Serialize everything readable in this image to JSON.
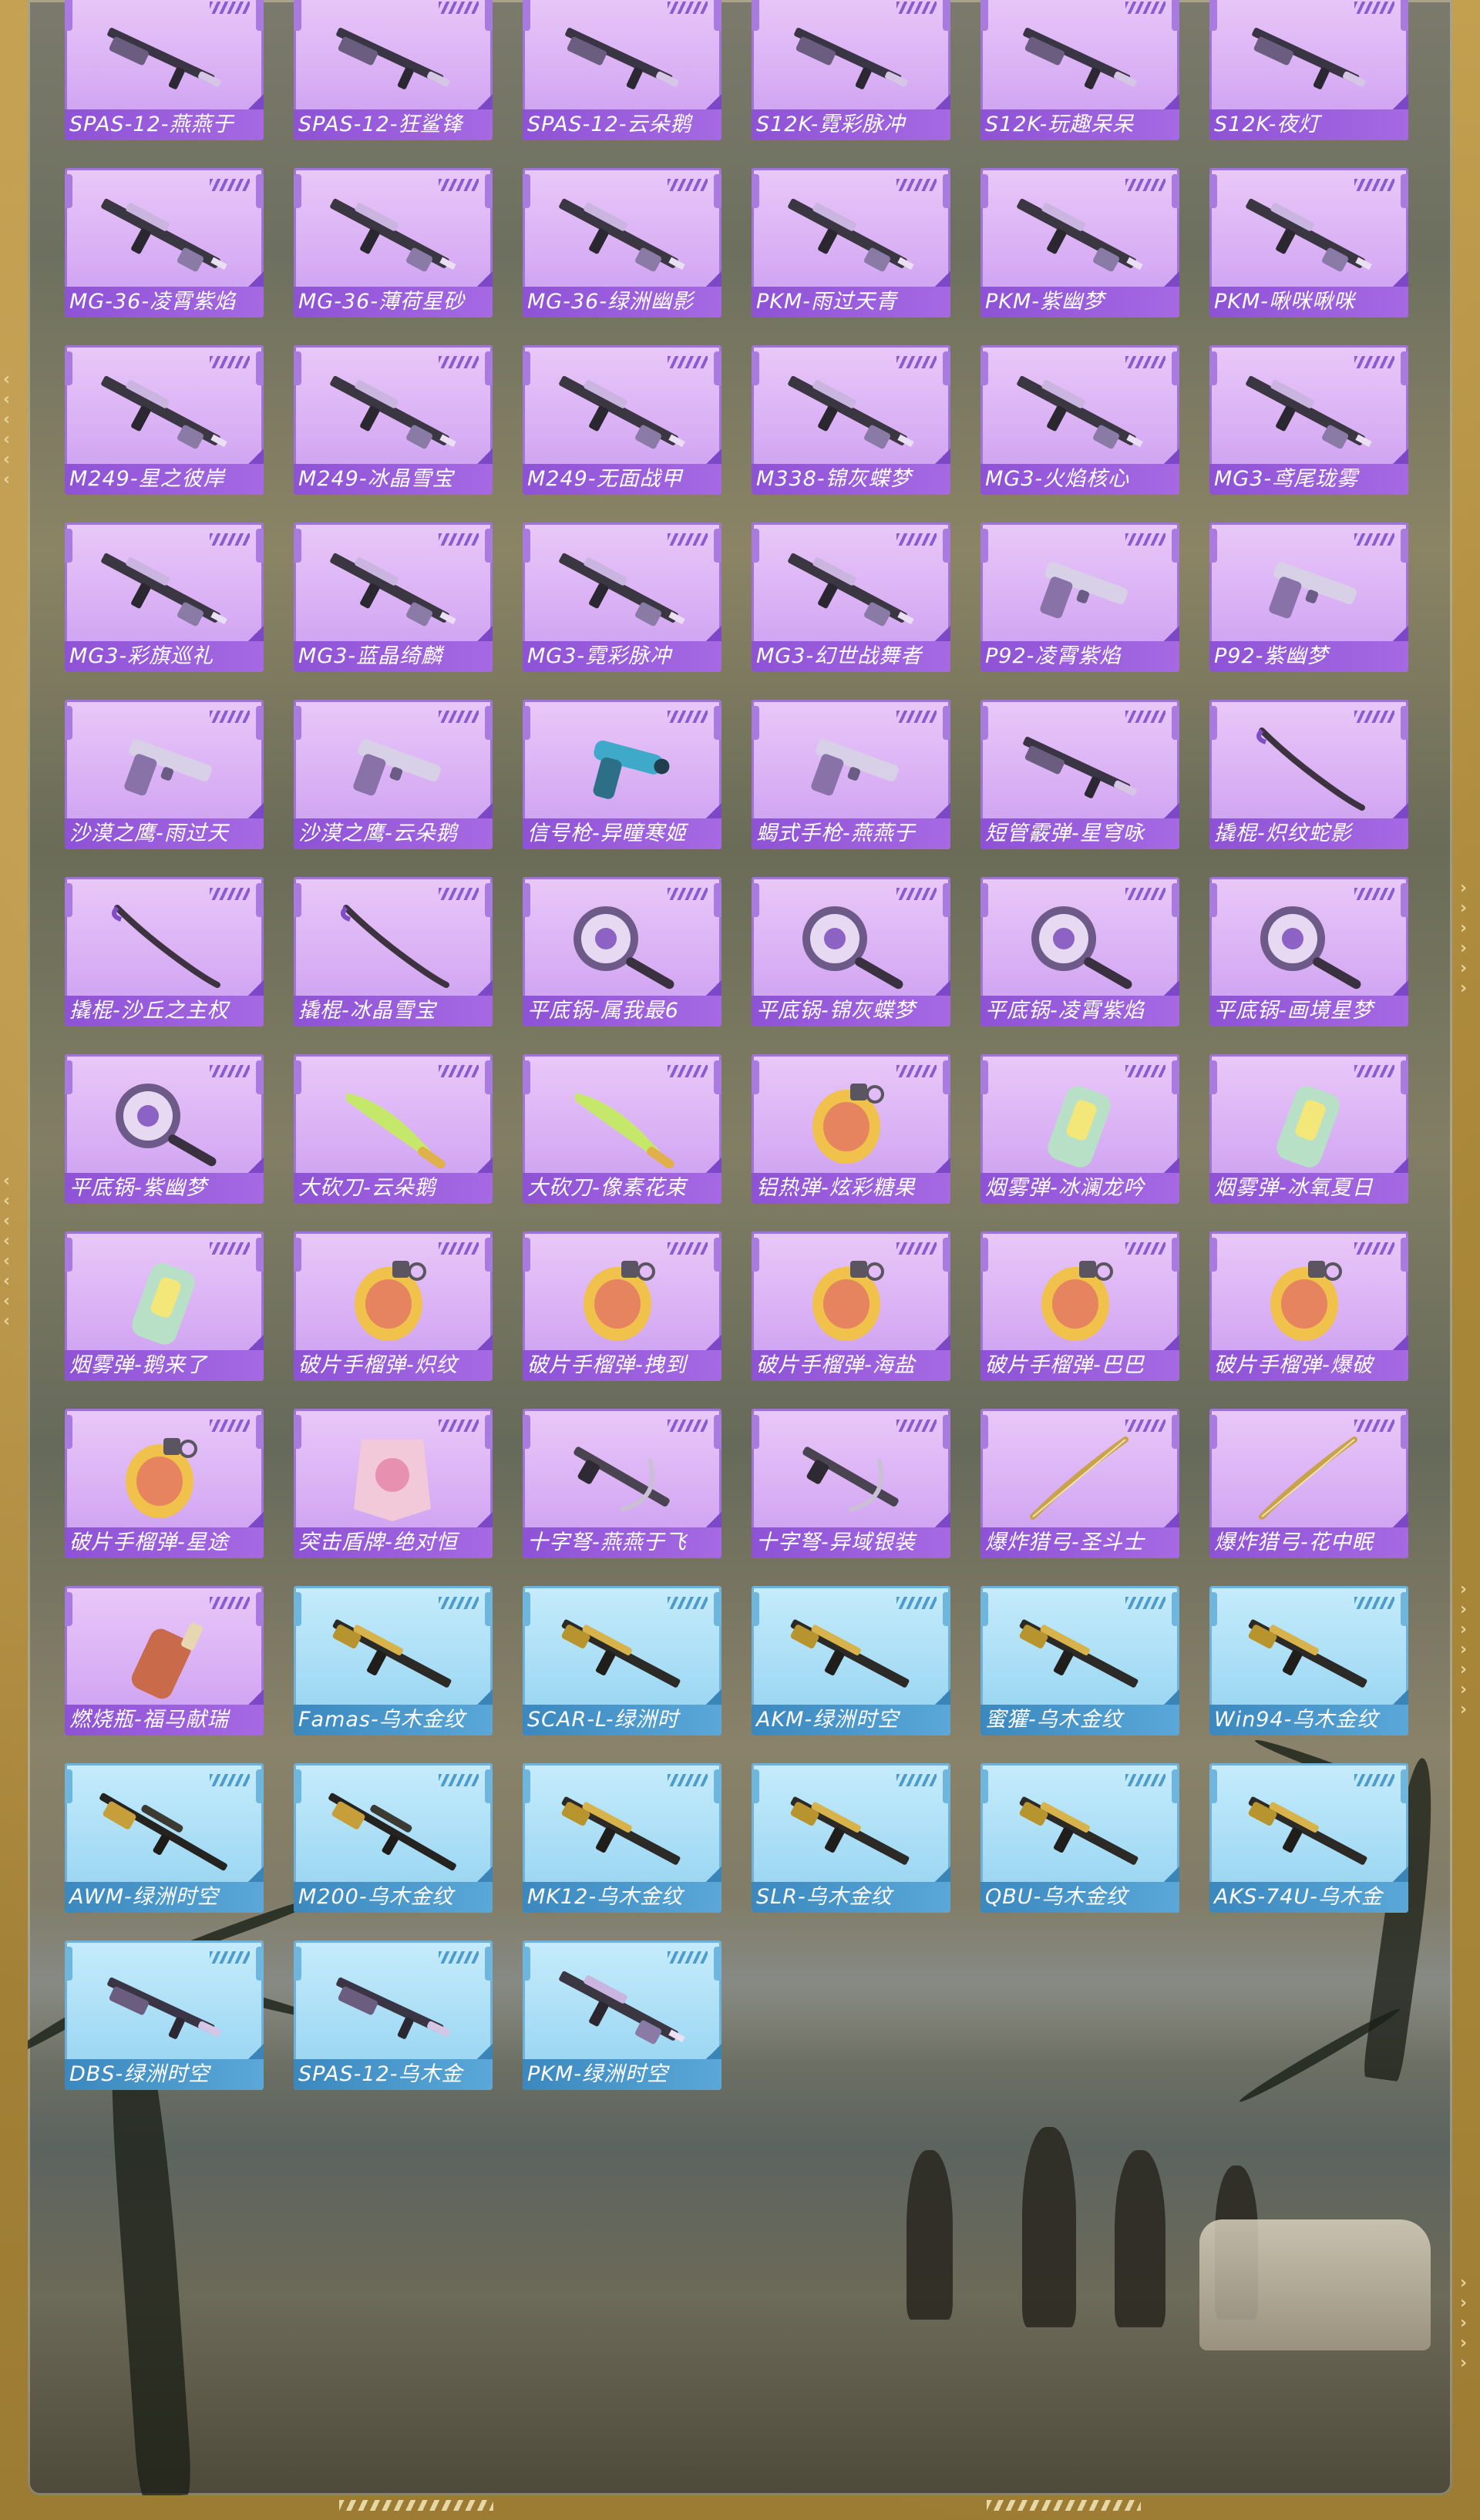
{
  "colors": {
    "frame_gold": "#b7913f",
    "card_purple": "#d8aef4",
    "card_purple_label": "#9a5fdd",
    "card_blue": "#a6dcf5",
    "card_blue_label": "#4a99cd"
  },
  "items": [
    {
      "label": "SPAS-12-燕燕于",
      "rarity": "purple",
      "icon": "shotgun-icon"
    },
    {
      "label": "SPAS-12-狂鲨锋",
      "rarity": "purple",
      "icon": "shotgun-icon"
    },
    {
      "label": "SPAS-12-云朵鹅",
      "rarity": "purple",
      "icon": "shotgun-icon"
    },
    {
      "label": "S12K-霓彩脉冲",
      "rarity": "purple",
      "icon": "shotgun-icon"
    },
    {
      "label": "S12K-玩趣呆呆",
      "rarity": "purple",
      "icon": "shotgun-icon"
    },
    {
      "label": "S12K-夜灯",
      "rarity": "purple",
      "icon": "shotgun-icon"
    },
    {
      "label": "MG-36-凌霄紫焰",
      "rarity": "purple",
      "icon": "machine-gun-icon"
    },
    {
      "label": "MG-36-薄荷星砂",
      "rarity": "purple",
      "icon": "machine-gun-icon"
    },
    {
      "label": "MG-36-绿洲幽影",
      "rarity": "purple",
      "icon": "machine-gun-icon"
    },
    {
      "label": "PKM-雨过天青",
      "rarity": "purple",
      "icon": "machine-gun-icon"
    },
    {
      "label": "PKM-紫幽梦",
      "rarity": "purple",
      "icon": "machine-gun-icon"
    },
    {
      "label": "PKM-啾咪啾咪",
      "rarity": "purple",
      "icon": "machine-gun-icon"
    },
    {
      "label": "M249-星之彼岸",
      "rarity": "purple",
      "icon": "machine-gun-icon"
    },
    {
      "label": "M249-冰晶雪宝",
      "rarity": "purple",
      "icon": "machine-gun-icon"
    },
    {
      "label": "M249-无面战甲",
      "rarity": "purple",
      "icon": "machine-gun-icon"
    },
    {
      "label": "M338-锦灰蝶梦",
      "rarity": "purple",
      "icon": "machine-gun-icon"
    },
    {
      "label": "MG3-火焰核心",
      "rarity": "purple",
      "icon": "machine-gun-icon"
    },
    {
      "label": "MG3-鸢尾珑雾",
      "rarity": "purple",
      "icon": "machine-gun-icon"
    },
    {
      "label": "MG3-彩旗巡礼",
      "rarity": "purple",
      "icon": "machine-gun-icon"
    },
    {
      "label": "MG3-蓝晶绮麟",
      "rarity": "purple",
      "icon": "machine-gun-icon"
    },
    {
      "label": "MG3-霓彩脉冲",
      "rarity": "purple",
      "icon": "machine-gun-icon"
    },
    {
      "label": "MG3-幻世战舞者",
      "rarity": "purple",
      "icon": "machine-gun-icon"
    },
    {
      "label": "P92-凌霄紫焰",
      "rarity": "purple",
      "icon": "pistol-icon"
    },
    {
      "label": "P92-紫幽梦",
      "rarity": "purple",
      "icon": "pistol-icon"
    },
    {
      "label": "沙漠之鹰-雨过天",
      "rarity": "purple",
      "icon": "pistol-icon"
    },
    {
      "label": "沙漠之鹰-云朵鹅",
      "rarity": "purple",
      "icon": "pistol-icon"
    },
    {
      "label": "信号枪-异瞳寒姬",
      "rarity": "purple",
      "icon": "flare-gun-icon"
    },
    {
      "label": "蝎式手枪-燕燕于",
      "rarity": "purple",
      "icon": "pistol-icon"
    },
    {
      "label": "短管霰弹-星穹咏",
      "rarity": "purple",
      "icon": "shotgun-icon"
    },
    {
      "label": "撬棍-炽纹蛇影",
      "rarity": "purple",
      "icon": "crowbar-icon"
    },
    {
      "label": "撬棍-沙丘之主权",
      "rarity": "purple",
      "icon": "crowbar-icon"
    },
    {
      "label": "撬棍-冰晶雪宝",
      "rarity": "purple",
      "icon": "crowbar-icon"
    },
    {
      "label": "平底锅-属我最6",
      "rarity": "purple",
      "icon": "pan-icon"
    },
    {
      "label": "平底锅-锦灰蝶梦",
      "rarity": "purple",
      "icon": "pan-icon"
    },
    {
      "label": "平底锅-凌霄紫焰",
      "rarity": "purple",
      "icon": "pan-icon"
    },
    {
      "label": "平底锅-画境星梦",
      "rarity": "purple",
      "icon": "pan-icon"
    },
    {
      "label": "平底锅-紫幽梦",
      "rarity": "purple",
      "icon": "pan-icon"
    },
    {
      "label": "大砍刀-云朵鹅",
      "rarity": "purple",
      "icon": "machete-icon"
    },
    {
      "label": "大砍刀-像素花束",
      "rarity": "purple",
      "icon": "machete-icon"
    },
    {
      "label": "铝热弹-炫彩糖果",
      "rarity": "purple",
      "icon": "grenade-icon"
    },
    {
      "label": "烟雾弹-冰澜龙吟",
      "rarity": "purple",
      "icon": "smoke-grenade-icon"
    },
    {
      "label": "烟雾弹-冰氧夏日",
      "rarity": "purple",
      "icon": "smoke-grenade-icon"
    },
    {
      "label": "烟雾弹-鹅来了",
      "rarity": "purple",
      "icon": "smoke-grenade-icon"
    },
    {
      "label": "破片手榴弹-炽纹",
      "rarity": "purple",
      "icon": "grenade-icon"
    },
    {
      "label": "破片手榴弹-拽到",
      "rarity": "purple",
      "icon": "grenade-icon"
    },
    {
      "label": "破片手榴弹-海盐",
      "rarity": "purple",
      "icon": "grenade-icon"
    },
    {
      "label": "破片手榴弹-巴巴",
      "rarity": "purple",
      "icon": "grenade-icon"
    },
    {
      "label": "破片手榴弹-爆破",
      "rarity": "purple",
      "icon": "grenade-icon"
    },
    {
      "label": "破片手榴弹-星途",
      "rarity": "purple",
      "icon": "grenade-icon"
    },
    {
      "label": "突击盾牌-绝对恒",
      "rarity": "purple",
      "icon": "shield-icon"
    },
    {
      "label": "十字弩-燕燕于飞",
      "rarity": "purple",
      "icon": "crossbow-icon"
    },
    {
      "label": "十字弩-异域银装",
      "rarity": "purple",
      "icon": "crossbow-icon"
    },
    {
      "label": "爆炸猎弓-圣斗士",
      "rarity": "purple",
      "icon": "bow-icon"
    },
    {
      "label": "爆炸猎弓-花中眠",
      "rarity": "purple",
      "icon": "bow-icon"
    },
    {
      "label": "燃烧瓶-福马献瑞",
      "rarity": "purple",
      "icon": "molotov-icon"
    },
    {
      "label": "Famas-乌木金纹",
      "rarity": "blue",
      "icon": "rifle-icon"
    },
    {
      "label": "SCAR-L-绿洲时",
      "rarity": "blue",
      "icon": "rifle-icon"
    },
    {
      "label": "AKM-绿洲时空",
      "rarity": "blue",
      "icon": "rifle-icon"
    },
    {
      "label": "蜜獾-乌木金纹",
      "rarity": "blue",
      "icon": "rifle-icon"
    },
    {
      "label": "Win94-乌木金纹",
      "rarity": "blue",
      "icon": "rifle-icon"
    },
    {
      "label": "AWM-绿洲时空",
      "rarity": "blue",
      "icon": "sniper-icon"
    },
    {
      "label": "M200-乌木金纹",
      "rarity": "blue",
      "icon": "sniper-icon"
    },
    {
      "label": "MK12-乌木金纹",
      "rarity": "blue",
      "icon": "rifle-icon"
    },
    {
      "label": "SLR-乌木金纹",
      "rarity": "blue",
      "icon": "rifle-icon"
    },
    {
      "label": "QBU-乌木金纹",
      "rarity": "blue",
      "icon": "rifle-icon"
    },
    {
      "label": "AKS-74U-乌木金",
      "rarity": "blue",
      "icon": "rifle-icon"
    },
    {
      "label": "DBS-绿洲时空",
      "rarity": "blue",
      "icon": "shotgun-icon"
    },
    {
      "label": "SPAS-12-乌木金",
      "rarity": "blue",
      "icon": "shotgun-icon"
    },
    {
      "label": "PKM-绿洲时空",
      "rarity": "blue",
      "icon": "machine-gun-icon"
    }
  ]
}
